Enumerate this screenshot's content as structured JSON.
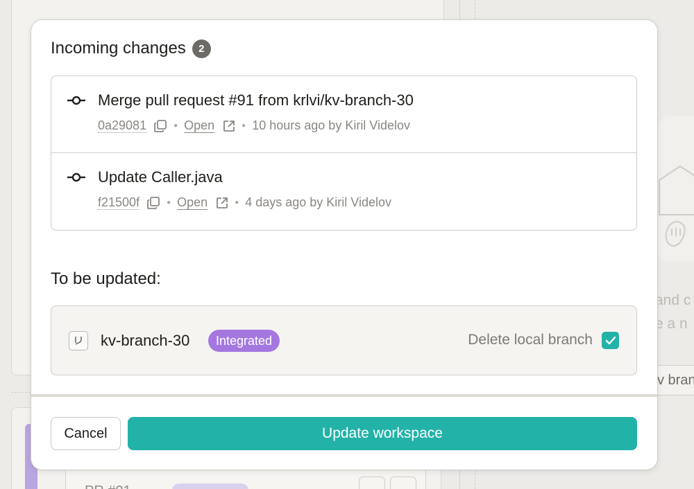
{
  "colors": {
    "accent": "#22b2a8",
    "integrated_badge": "#a477e0",
    "count_badge": "#6e6b66",
    "backdrop": "#ecebe8"
  },
  "background": {
    "empty_text_line1": "and c",
    "empty_text_line2": "e a n",
    "new_branch_button": "v bran",
    "lane_title": "PR #91"
  },
  "dialog": {
    "title": "Incoming changes",
    "incoming_count": "2",
    "commits": [
      {
        "title": "Merge pull request #91 from krlvi/kv-branch-30",
        "sha": "0a29081",
        "open_label": "Open",
        "time_author": "10 hours ago by Kiril Videlov",
        "icon": "commit-icon"
      },
      {
        "title": "Update Caller.java",
        "sha": "f21500f",
        "open_label": "Open",
        "time_author": "4 days ago by Kiril Videlov",
        "icon": "commit-icon"
      }
    ],
    "to_be_updated_title": "To be updated:",
    "branch": {
      "name": "kv-branch-30",
      "status_tag": "Integrated",
      "delete_label": "Delete local branch",
      "delete_checked": true,
      "icon": "branch-icon"
    },
    "cancel_label": "Cancel",
    "update_label": "Update workspace"
  }
}
